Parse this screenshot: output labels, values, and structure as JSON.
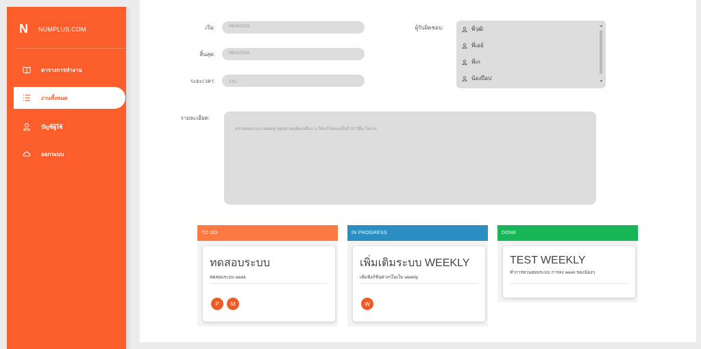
{
  "sidebar": {
    "brand_letter": "N",
    "brand_name": "NUMPLUS.COM",
    "items": [
      {
        "label": "ตารางการทำงาน",
        "icon": "book-icon"
      },
      {
        "label": "งานทั้งหมด",
        "icon": "list-icon",
        "active": true
      },
      {
        "label": "บัญชีผู้ใช้",
        "icon": "user-icon"
      },
      {
        "label": "ออกระบบ",
        "icon": "cloud-icon"
      }
    ],
    "accent": "#fb5e2b"
  },
  "form": {
    "start_label": "เริ่ม:",
    "start_value": "08/20/2018",
    "end_label": "สิ้นสุด:",
    "end_value": "08/21/2018",
    "duration_label": "ระยะเวลา:",
    "duration_value": "1วัน",
    "assignee_label": "ผู้รับผิดชอบ:",
    "assignees": [
      "พี่วุฒิ",
      "พี่เอย์",
      "พี่เก",
      "น้องป๊อป"
    ],
    "detail_label": "รายละเอียด:",
    "detail_text": "ตรวจสอบระบบ weekly report ของทีมเหลือวาง ให้แก้ไขจนเสร็จที่ 31 วิสิ้น ใจงาน"
  },
  "board": {
    "columns": [
      {
        "title": "TO DO",
        "color": "#fb7a42",
        "cards": [
          {
            "title": "ทดสอบระบบ",
            "subtitle": "ทดสอบระบบ week",
            "avatars": [
              "P",
              "M"
            ]
          }
        ]
      },
      {
        "title": "IN PROGRESS",
        "color": "#2b8dc0",
        "cards": [
          {
            "title": "เพิ่มเติมระบบ WEEKLY",
            "subtitle": "เพิ่มฟังก์ชั่นต่างๆในเว็บ weekly",
            "avatars": [
              "W"
            ]
          }
        ]
      },
      {
        "title": "DONE",
        "color": "#18b559",
        "cards": [
          {
            "title": "TEST WEEKLY",
            "subtitle": "ทำการทวนสอบระบบ การลง week ของน้องๆ",
            "avatars": []
          }
        ]
      }
    ]
  }
}
